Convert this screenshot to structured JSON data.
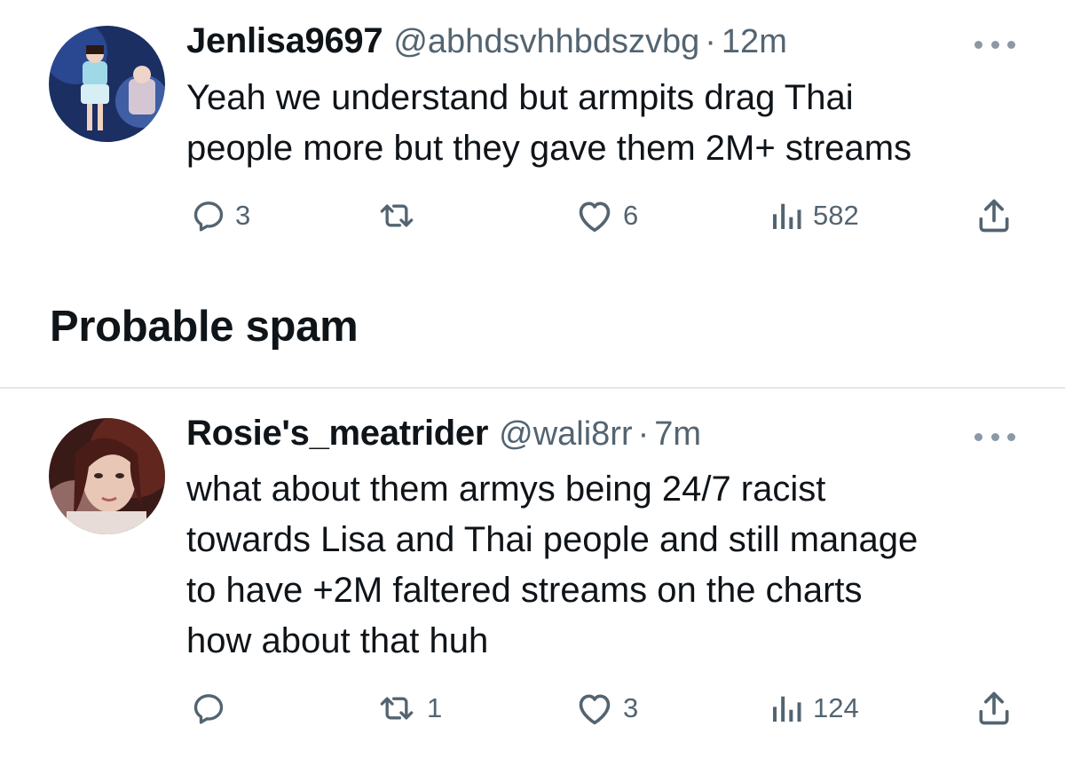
{
  "tweets": [
    {
      "display_name": "Jenlisa9697",
      "handle": "@abhdsvhhbdszvbg",
      "separator": "·",
      "time": "12m",
      "lines": [
        "Yeah we understand but armpits drag Thai",
        "people more but they gave them 2M+ streams"
      ],
      "replies": "3",
      "retweets": "",
      "likes": "6",
      "views": "582"
    },
    {
      "display_name": "Rosie's_meatrider",
      "handle": "@wali8rr",
      "separator": "·",
      "time": "7m",
      "lines": [
        "what about them armys being 24/7 racist",
        "towards Lisa and Thai people and still manage",
        "to have +2M faltered streams on the charts",
        "how about that huh"
      ],
      "replies": "",
      "retweets": "1",
      "likes": "3",
      "views": "124"
    }
  ],
  "section": {
    "title": "Probable spam"
  },
  "icons": {
    "reply": "reply-icon",
    "retweet": "retweet-icon",
    "like": "heart-icon",
    "views": "views-icon",
    "share": "share-icon",
    "more": "more-icon"
  },
  "colors": {
    "text": "#0f1419",
    "secondary": "#536471",
    "divider": "#e4e7ea"
  }
}
